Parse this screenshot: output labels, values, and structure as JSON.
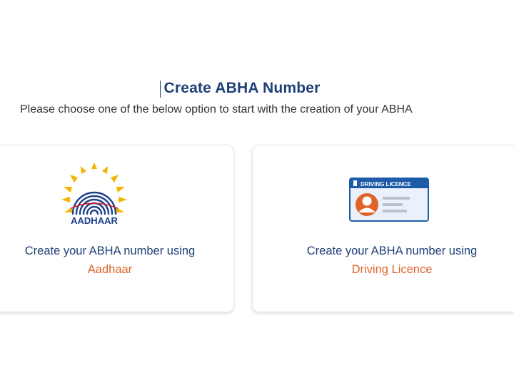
{
  "page": {
    "title": "Create ABHA Number",
    "subtitle": "Please choose one of the below option to start with the creation of your ABHA"
  },
  "options": [
    {
      "line1": "Create your ABHA number using",
      "line2": "Aadhaar",
      "logo_text": "AADHAAR",
      "icon": "aadhaar-logo"
    },
    {
      "line1": "Create your ABHA number using",
      "line2": "Driving Licence",
      "logo_text": "DRIVING LICENCE",
      "icon": "driving-licence-card-icon"
    }
  ],
  "colors": {
    "title": "#1f3f77",
    "accent": "#e0642a",
    "aadhaar_sun": "#f4b400",
    "aadhaar_fingerprint": "#1c3f8a",
    "licence_header": "#1d5aa8"
  }
}
